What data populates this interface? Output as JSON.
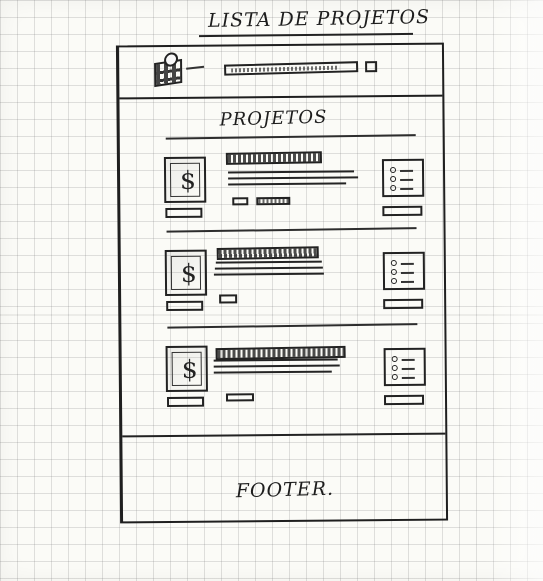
{
  "sketch": {
    "title": "LISTA DE PROJETOS",
    "section_title": "PROJETOS",
    "footer": "FOOTER.",
    "currency_symbol": "$"
  }
}
